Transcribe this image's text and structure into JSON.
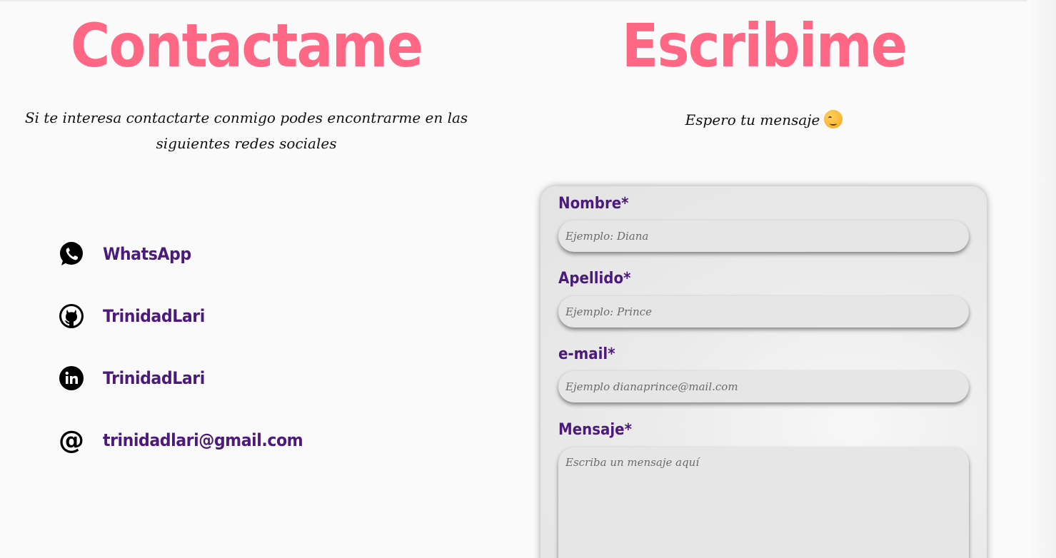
{
  "contact": {
    "title": "Contactame",
    "description": "Si te interesa contactarte conmigo podes encontrarme en las siguientes redes sociales",
    "items": [
      {
        "icon": "whatsapp-icon",
        "label": "WhatsApp"
      },
      {
        "icon": "github-icon",
        "label": "TrinidadLari"
      },
      {
        "icon": "linkedin-icon",
        "label": "TrinidadLari"
      },
      {
        "icon": "at-sign-icon",
        "label": "trinidadlari@gmail.com"
      }
    ]
  },
  "write": {
    "title": "Escribime",
    "subtitle": "Espero tu mensaje",
    "subtitle_emoji": "winking-face-emoji"
  },
  "form": {
    "fields": [
      {
        "label": "Nombre*",
        "placeholder": "Ejemplo: Diana"
      },
      {
        "label": "Apellido*",
        "placeholder": "Ejemplo: Prince"
      },
      {
        "label": "e-mail*",
        "placeholder": "Ejemplo dianaprince@mail.com"
      },
      {
        "label": "Mensaje*",
        "placeholder": "Escriba un mensaje aquí"
      }
    ]
  },
  "colors": {
    "title_pink": "#ff6785",
    "link_purple": "#4c1a7a",
    "background": "#fafafa",
    "input_bg": "#e6e6e6"
  }
}
